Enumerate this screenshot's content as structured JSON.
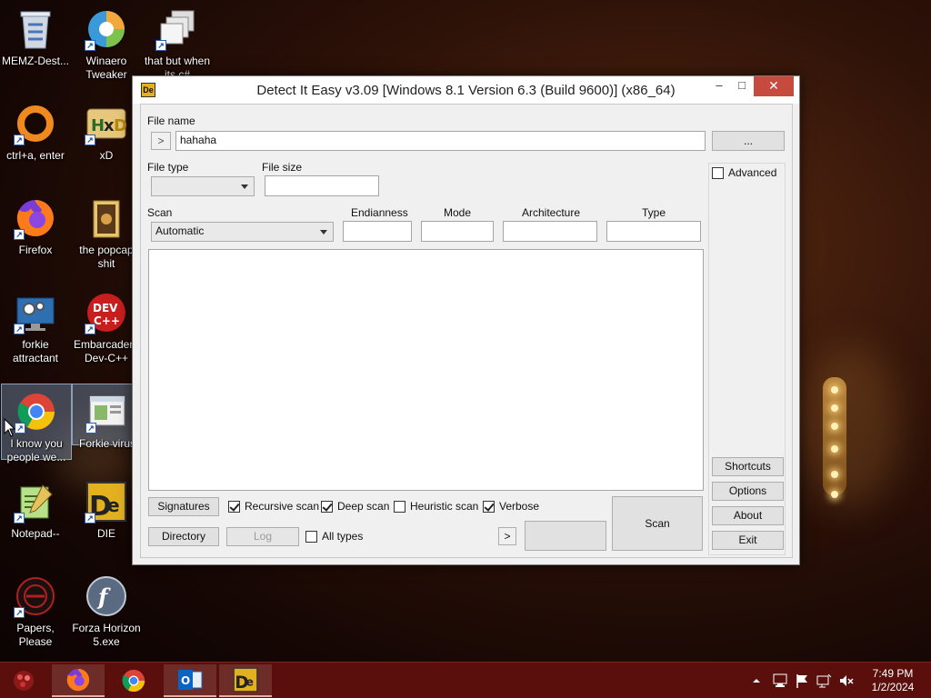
{
  "desktop": {
    "icons": [
      {
        "label": "MEMZ-Dest...",
        "icon": "recycle-bin-icon"
      },
      {
        "label": "Winaero Tweaker",
        "icon": "winaero-icon"
      },
      {
        "label": "that but when its c#",
        "icon": "windows-stack-icon"
      },
      {
        "label": "ctrl+a, enter",
        "icon": "orange-ring-icon"
      },
      {
        "label": "xD",
        "icon": "hxd-icon"
      },
      {
        "label": "Firefox",
        "icon": "firefox-icon"
      },
      {
        "label": "the popcap shit",
        "icon": "folder-icon"
      },
      {
        "label": "forkie attractant",
        "icon": "monitor-gear-icon"
      },
      {
        "label": "Embarcadero Dev-C++",
        "icon": "devcpp-icon"
      },
      {
        "label": "I know you people we...",
        "icon": "chrome-icon"
      },
      {
        "label": "Forkie virus",
        "icon": "app-window-icon"
      },
      {
        "label": "Notepad--",
        "icon": "notepad-icon"
      },
      {
        "label": "DIE",
        "icon": "die-icon"
      },
      {
        "label": "Papers, Please",
        "icon": "papers-please-icon"
      },
      {
        "label": "Forza Horizon 5.exe",
        "icon": "flash-icon"
      }
    ]
  },
  "window": {
    "title": "Detect It Easy v3.09 [Windows 8.1 Version 6.3 (Build 9600)] (x86_64)",
    "minimize": "–",
    "maximize": "□",
    "close": "✕",
    "file_name_label": "File name",
    "file_name_value": "hahaha",
    "history_button": ">",
    "browse_button": "...",
    "file_type_label": "File type",
    "file_size_label": "File size",
    "scan_label": "Scan",
    "scan_mode": "Automatic",
    "endianness_label": "Endianness",
    "mode_label": "Mode",
    "architecture_label": "Architecture",
    "type_label": "Type",
    "advanced_label": "Advanced",
    "shortcuts_button": "Shortcuts",
    "options_button": "Options",
    "about_button": "About",
    "exit_button": "Exit",
    "signatures_button": "Signatures",
    "recursive_scan_label": "Recursive scan",
    "deep_scan_label": "Deep scan",
    "heuristic_scan_label": "Heuristic scan",
    "verbose_label": "Verbose",
    "directory_button": "Directory",
    "log_button": "Log",
    "all_types_label": "All types",
    "arrow_button": ">",
    "scan_button": "Scan",
    "checks": {
      "recursive": true,
      "deep": true,
      "heuristic": false,
      "verbose": true,
      "all_types": false,
      "advanced": false
    }
  },
  "taskbar": {
    "clock_time": "7:49 PM",
    "clock_date": "1/2/2024"
  }
}
